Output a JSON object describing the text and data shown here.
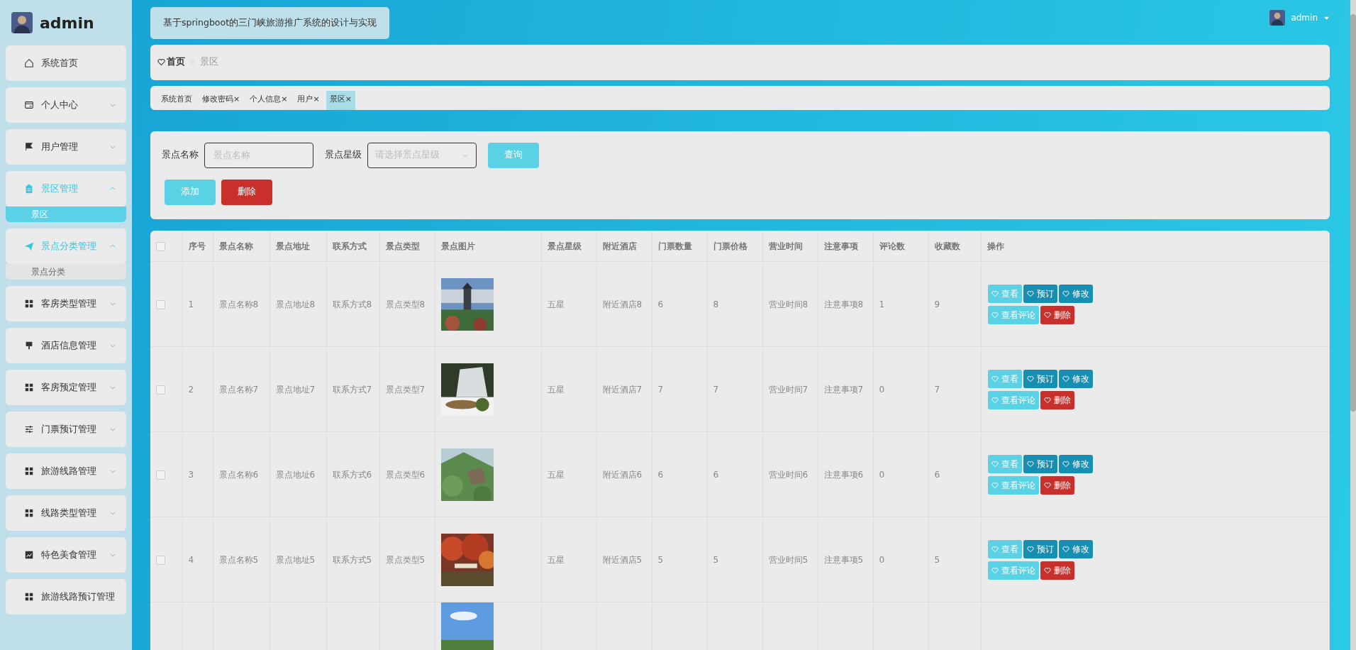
{
  "sidebar": {
    "user": "admin",
    "items": [
      {
        "label": "系统首页",
        "kind": "link"
      },
      {
        "label": "个人中心",
        "kind": "menu",
        "expanded": false
      },
      {
        "label": "用户管理",
        "kind": "menu",
        "expanded": false
      },
      {
        "label": "景区管理",
        "kind": "menu",
        "expanded": true,
        "children": [
          {
            "label": "景区",
            "selected": true
          }
        ]
      },
      {
        "label": "景点分类管理",
        "kind": "menu",
        "expanded": true,
        "children": [
          {
            "label": "景点分类",
            "selected": false
          }
        ]
      },
      {
        "label": "客房类型管理",
        "kind": "menu",
        "expanded": false
      },
      {
        "label": "酒店信息管理",
        "kind": "menu",
        "expanded": false
      },
      {
        "label": "客房预定管理",
        "kind": "menu",
        "expanded": false
      },
      {
        "label": "门票预订管理",
        "kind": "menu",
        "expanded": false
      },
      {
        "label": "旅游线路管理",
        "kind": "menu",
        "expanded": false
      },
      {
        "label": "线路类型管理",
        "kind": "menu",
        "expanded": false
      },
      {
        "label": "特色美食管理",
        "kind": "menu",
        "expanded": false
      },
      {
        "label": "旅游线路预订管理",
        "kind": "link"
      }
    ]
  },
  "header": {
    "title": "基于springboot的三门峡旅游推广系统的设计与实现",
    "user": "admin"
  },
  "breadcrumb": [
    {
      "label": "首页"
    },
    {
      "label": "景区"
    }
  ],
  "tabs": [
    {
      "label": "系统首页",
      "selected": false
    },
    {
      "label": "修改密码",
      "close": "×",
      "selected": false
    },
    {
      "label": "个人信息",
      "close": "×",
      "selected": false
    },
    {
      "label": "用户",
      "close": "×",
      "selected": false
    },
    {
      "label": "景区",
      "close": "×",
      "selected": true
    }
  ],
  "filter": {
    "name_label": "景点名称",
    "name_placeholder": "景点名称",
    "level_label": "景点星级",
    "level_placeholder": "请选择景点星级",
    "search_button": "查询",
    "add_button": "添加",
    "delete_button": "删除"
  },
  "table": {
    "select_all": false,
    "columns": [
      "序号",
      "景点名称",
      "景点地址",
      "联系方式",
      "景点类型",
      "景点图片",
      "景点星级",
      "附近酒店",
      "门票数量",
      "门票价格",
      "营业时间",
      "注意事项",
      "评论数",
      "收藏数",
      "操作"
    ],
    "rows": [
      {
        "checked": false,
        "cells": [
          "1",
          "景点名称8",
          "景点地址8",
          "联系方式8",
          "景点类型8",
          "五星",
          "附近酒店8",
          "6",
          "8",
          "营业时间8",
          "注意事项8",
          "1",
          "9"
        ],
        "picture": {
          "kind": "picture"
        },
        "actions": [
          {
            "label": "查看",
            "kind": "info"
          },
          {
            "label": "预订",
            "kind": "primary"
          },
          {
            "label": "修改",
            "kind": "primary"
          },
          {
            "label": "查看评论",
            "kind": "info"
          },
          {
            "label": "删除",
            "kind": "danger"
          }
        ]
      },
      {
        "checked": false,
        "cells": [
          "2",
          "景点名称7",
          "景点地址7",
          "联系方式7",
          "景点类型7",
          "五星",
          "附近酒店7",
          "7",
          "7",
          "营业时间7",
          "注意事项7",
          "0",
          "7"
        ],
        "picture": {
          "kind": "picture"
        },
        "actions": [
          {
            "label": "查看",
            "kind": "info"
          },
          {
            "label": "预订",
            "kind": "primary"
          },
          {
            "label": "修改",
            "kind": "primary"
          },
          {
            "label": "查看评论",
            "kind": "info"
          },
          {
            "label": "删除",
            "kind": "danger"
          }
        ]
      },
      {
        "checked": false,
        "cells": [
          "3",
          "景点名称6",
          "景点地址6",
          "联系方式6",
          "景点类型6",
          "五星",
          "附近酒店6",
          "6",
          "6",
          "营业时间6",
          "注意事项6",
          "0",
          "6"
        ],
        "picture": {
          "kind": "picture"
        },
        "actions": [
          {
            "label": "查看",
            "kind": "info"
          },
          {
            "label": "预订",
            "kind": "primary"
          },
          {
            "label": "修改",
            "kind": "primary"
          },
          {
            "label": "查看评论",
            "kind": "info"
          },
          {
            "label": "删除",
            "kind": "danger"
          }
        ]
      },
      {
        "checked": false,
        "cells": [
          "4",
          "景点名称5",
          "景点地址5",
          "联系方式5",
          "景点类型5",
          "五星",
          "附近酒店5",
          "5",
          "5",
          "营业时间5",
          "注意事项5",
          "0",
          "5"
        ],
        "picture": {
          "kind": "picture"
        },
        "actions": [
          {
            "label": "查看",
            "kind": "info"
          },
          {
            "label": "预订",
            "kind": "primary"
          },
          {
            "label": "修改",
            "kind": "primary"
          },
          {
            "label": "查看评论",
            "kind": "info"
          },
          {
            "label": "删除",
            "kind": "danger"
          }
        ]
      },
      {
        "picture": {
          "kind": "picture"
        }
      }
    ]
  }
}
